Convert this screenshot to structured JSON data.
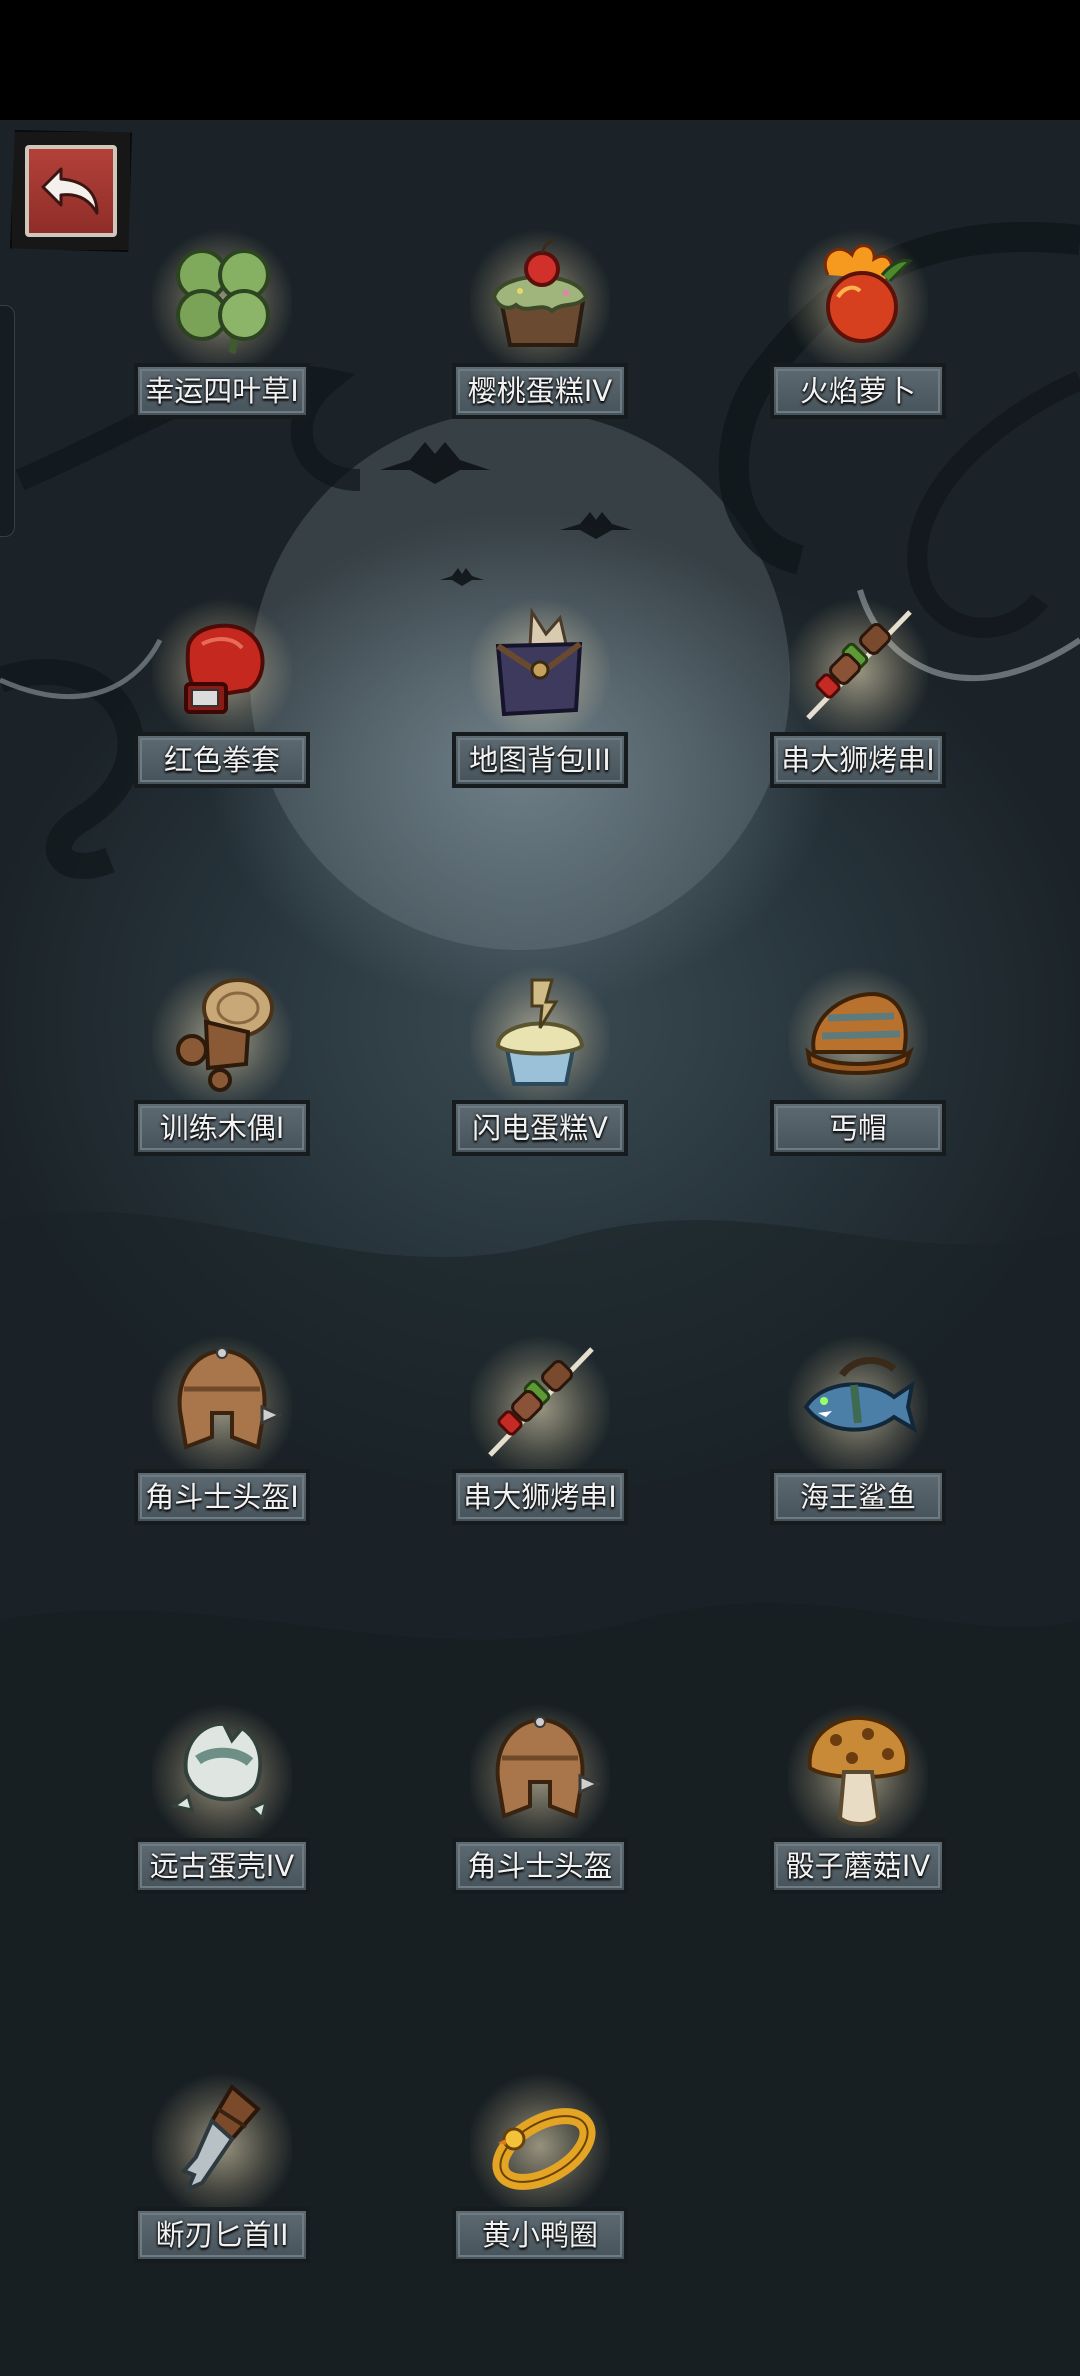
{
  "nav": {
    "back_icon": "return-arrow-icon"
  },
  "items": [
    {
      "name": "幸运四叶草I",
      "icon": "four-leaf-clover-icon"
    },
    {
      "name": "樱桃蛋糕IV",
      "icon": "cherry-cake-icon"
    },
    {
      "name": "火焰萝卜",
      "icon": "fire-radish-icon"
    },
    {
      "name": "红色拳套",
      "icon": "red-boxing-glove-icon"
    },
    {
      "name": "地图背包III",
      "icon": "map-backpack-icon"
    },
    {
      "name": "串大狮烤串I",
      "icon": "meat-skewer-icon"
    },
    {
      "name": "训练木偶I",
      "icon": "wooden-dummy-icon"
    },
    {
      "name": "闪电蛋糕V",
      "icon": "lightning-cupcake-icon"
    },
    {
      "name": "丐帽",
      "icon": "beggar-hat-icon"
    },
    {
      "name": "角斗士头盔I",
      "icon": "gladiator-helmet-icon"
    },
    {
      "name": "串大狮烤串I",
      "icon": "meat-skewer-icon"
    },
    {
      "name": "海王鲨鱼",
      "icon": "shark-fish-icon"
    },
    {
      "name": "远古蛋壳IV",
      "icon": "ancient-eggshell-icon"
    },
    {
      "name": "角斗士头盔",
      "icon": "gladiator-helmet-icon"
    },
    {
      "name": "骰子蘑菇IV",
      "icon": "dice-mushroom-icon"
    },
    {
      "name": "断刃匕首II",
      "icon": "broken-dagger-icon"
    },
    {
      "name": "黄小鸭圈",
      "icon": "yellow-duck-ring-icon"
    }
  ]
}
